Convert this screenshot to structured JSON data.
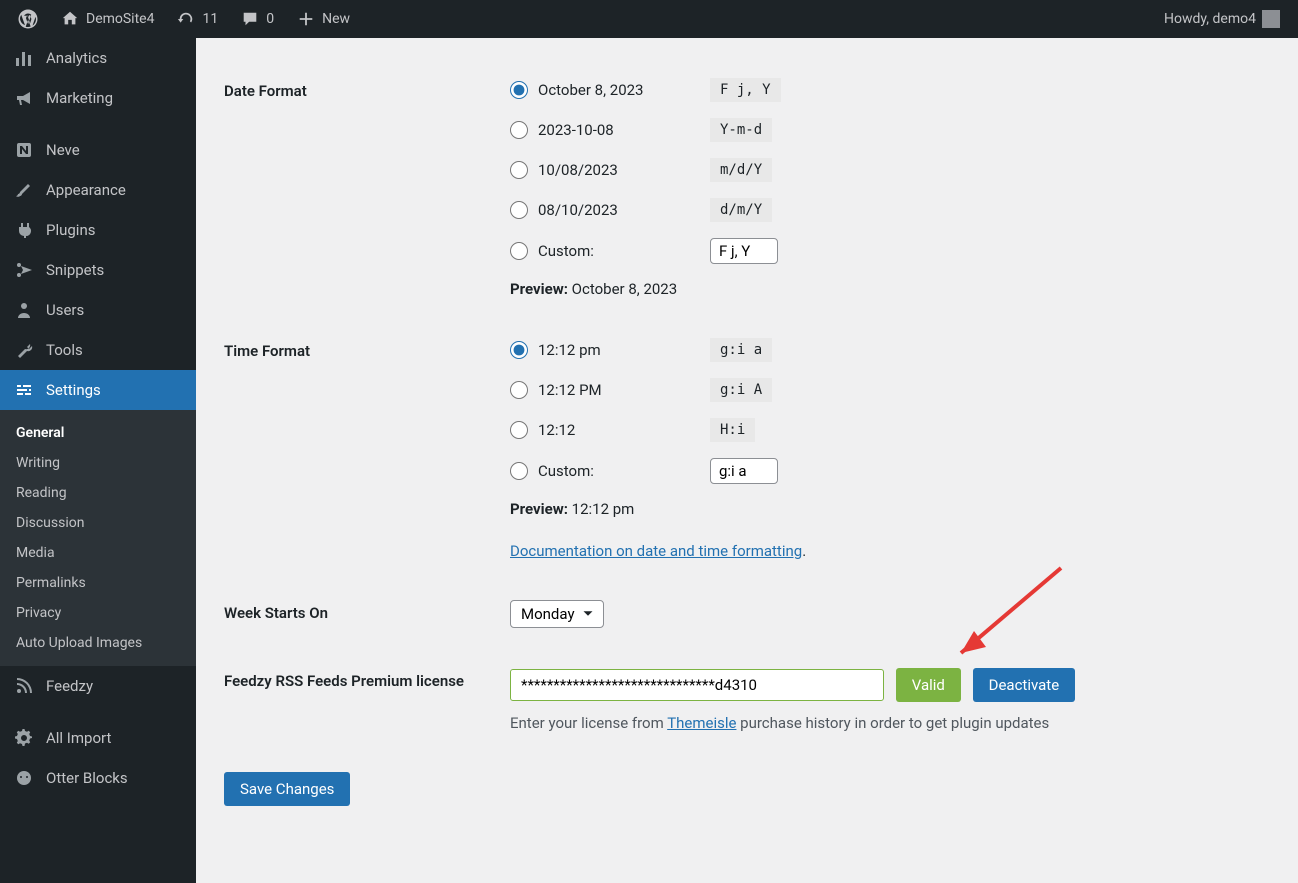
{
  "adminbar": {
    "site_name": "DemoSite4",
    "updates": "11",
    "comments": "0",
    "new": "New",
    "howdy": "Howdy, demo4"
  },
  "sidebar": {
    "items": [
      {
        "label": "Analytics"
      },
      {
        "label": "Marketing"
      },
      {
        "label": "Neve"
      },
      {
        "label": "Appearance"
      },
      {
        "label": "Plugins"
      },
      {
        "label": "Snippets"
      },
      {
        "label": "Users"
      },
      {
        "label": "Tools"
      },
      {
        "label": "Settings"
      },
      {
        "label": "Feedzy"
      },
      {
        "label": "All Import"
      },
      {
        "label": "Otter Blocks"
      }
    ],
    "submenu": [
      {
        "label": "General"
      },
      {
        "label": "Writing"
      },
      {
        "label": "Reading"
      },
      {
        "label": "Discussion"
      },
      {
        "label": "Media"
      },
      {
        "label": "Permalinks"
      },
      {
        "label": "Privacy"
      },
      {
        "label": "Auto Upload Images"
      }
    ]
  },
  "date_format": {
    "heading": "Date Format",
    "options": [
      {
        "display": "October 8, 2023",
        "code": "F j, Y",
        "selected": true
      },
      {
        "display": "2023-10-08",
        "code": "Y-m-d",
        "selected": false
      },
      {
        "display": "10/08/2023",
        "code": "m/d/Y",
        "selected": false
      },
      {
        "display": "08/10/2023",
        "code": "d/m/Y",
        "selected": false
      }
    ],
    "custom_label": "Custom:",
    "custom_value": "F j, Y",
    "preview_label": "Preview:",
    "preview_value": "October 8, 2023"
  },
  "time_format": {
    "heading": "Time Format",
    "options": [
      {
        "display": "12:12 pm",
        "code": "g:i a",
        "selected": true
      },
      {
        "display": "12:12 PM",
        "code": "g:i A",
        "selected": false
      },
      {
        "display": "12:12",
        "code": "H:i",
        "selected": false
      }
    ],
    "custom_label": "Custom:",
    "custom_value": "g:i a",
    "preview_label": "Preview:",
    "preview_value": "12:12 pm",
    "doc_link": "Documentation on date and time formatting",
    "doc_period": "."
  },
  "week": {
    "heading": "Week Starts On",
    "value": "Monday"
  },
  "license": {
    "heading": "Feedzy RSS Feeds Premium license",
    "value": "******************************d4310",
    "valid_btn": "Valid",
    "deactivate_btn": "Deactivate",
    "desc_before": "Enter your license from ",
    "desc_link": "Themeisle",
    "desc_after": " purchase history in order to get plugin updates"
  },
  "save_btn": "Save Changes"
}
